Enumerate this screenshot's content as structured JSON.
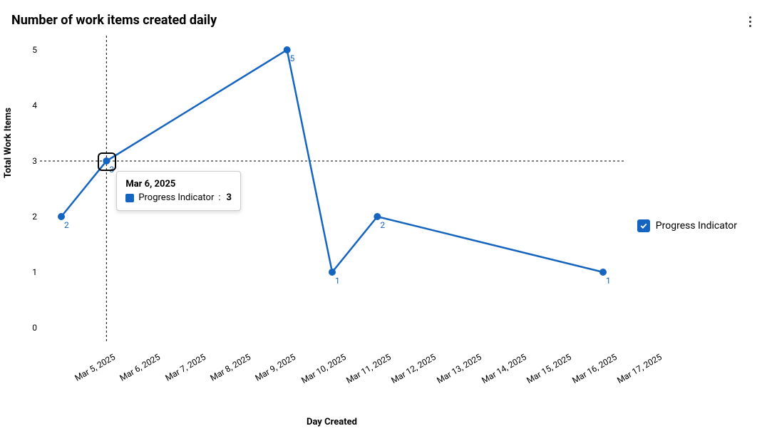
{
  "title": "Number of work items created daily",
  "legend": {
    "label": "Progress Indicator",
    "checked": true
  },
  "tooltip": {
    "date": "Mar 6, 2025",
    "series": "Progress Indicator",
    "value": "3",
    "at_index": 1
  },
  "chart_data": {
    "type": "line",
    "title": "Number of work items created daily",
    "xlabel": "Day Created",
    "ylabel": "Total Work Items",
    "ylim": [
      0,
      5
    ],
    "yticks": [
      0,
      1,
      2,
      3,
      4,
      5
    ],
    "categories": [
      "Mar 5, 2025",
      "Mar 6, 2025",
      "Mar 7, 2025",
      "Mar 8, 2025",
      "Mar 9, 2025",
      "Mar 10, 2025",
      "Mar 11, 2025",
      "Mar 12, 2025",
      "Mar 13, 2025",
      "Mar 14, 2025",
      "Mar 15, 2025",
      "Mar 16, 2025",
      "Mar 17, 2025"
    ],
    "series": [
      {
        "name": "Progress Indicator",
        "color": "#1565c0",
        "values": [
          2,
          3,
          null,
          null,
          null,
          5,
          1,
          2,
          null,
          null,
          null,
          null,
          1
        ]
      }
    ],
    "crosshair_at": "Mar 6, 2025"
  }
}
